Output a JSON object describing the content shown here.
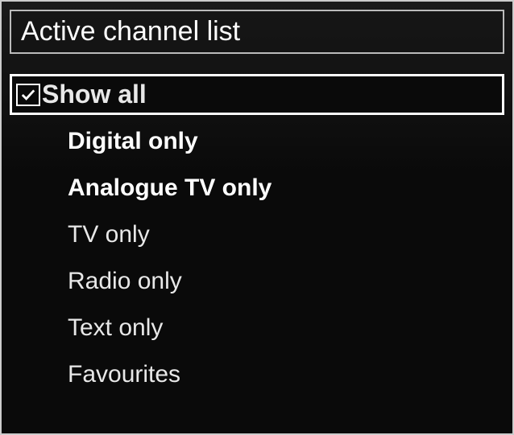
{
  "title": "Active channel list",
  "items": [
    {
      "label": "Show all",
      "checked": true,
      "selected": true,
      "bold": false
    },
    {
      "label": "Digital only",
      "checked": false,
      "selected": false,
      "bold": true
    },
    {
      "label": "Analogue TV only",
      "checked": false,
      "selected": false,
      "bold": true
    },
    {
      "label": "TV only",
      "checked": false,
      "selected": false,
      "bold": false
    },
    {
      "label": "Radio only",
      "checked": false,
      "selected": false,
      "bold": false
    },
    {
      "label": "Text only",
      "checked": false,
      "selected": false,
      "bold": false
    },
    {
      "label": "Favourites",
      "checked": false,
      "selected": false,
      "bold": false
    }
  ]
}
